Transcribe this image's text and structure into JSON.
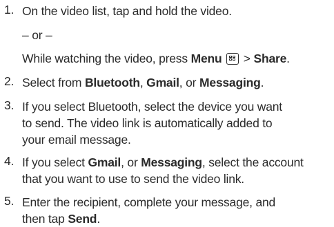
{
  "steps": [
    {
      "num": "1.",
      "text": "On the video list, tap and hold the video.",
      "or": "– or –",
      "alt_prefix": "While watching the video, press ",
      "alt_menu": "Menu",
      "alt_sep": " > ",
      "alt_share": "Share",
      "alt_suffix": "."
    },
    {
      "num": "2.",
      "prefix": "Select from ",
      "opt1": "Bluetooth",
      "sep1": ", ",
      "opt2": "Gmail",
      "sep2": ", or ",
      "opt3": "Messaging",
      "suffix": "."
    },
    {
      "num": "3.",
      "line1": "If you select Bluetooth, select the device you want",
      "line2": "to send. The video link is automatically added to",
      "line3": "your email message."
    },
    {
      "num": "4.",
      "prefix": "If you select ",
      "opt1": "Gmail",
      "sep1": ", or ",
      "opt2": "Messaging",
      "rest1": ", select the account",
      "line2": "that you want to use to send the video link."
    },
    {
      "num": "5.",
      "line1": "Enter the recipient, complete your message, and",
      "line2_prefix": "then tap ",
      "line2_bold": "Send",
      "line2_suffix": "."
    }
  ],
  "icons": {
    "menu_key": "menu-key-icon"
  }
}
